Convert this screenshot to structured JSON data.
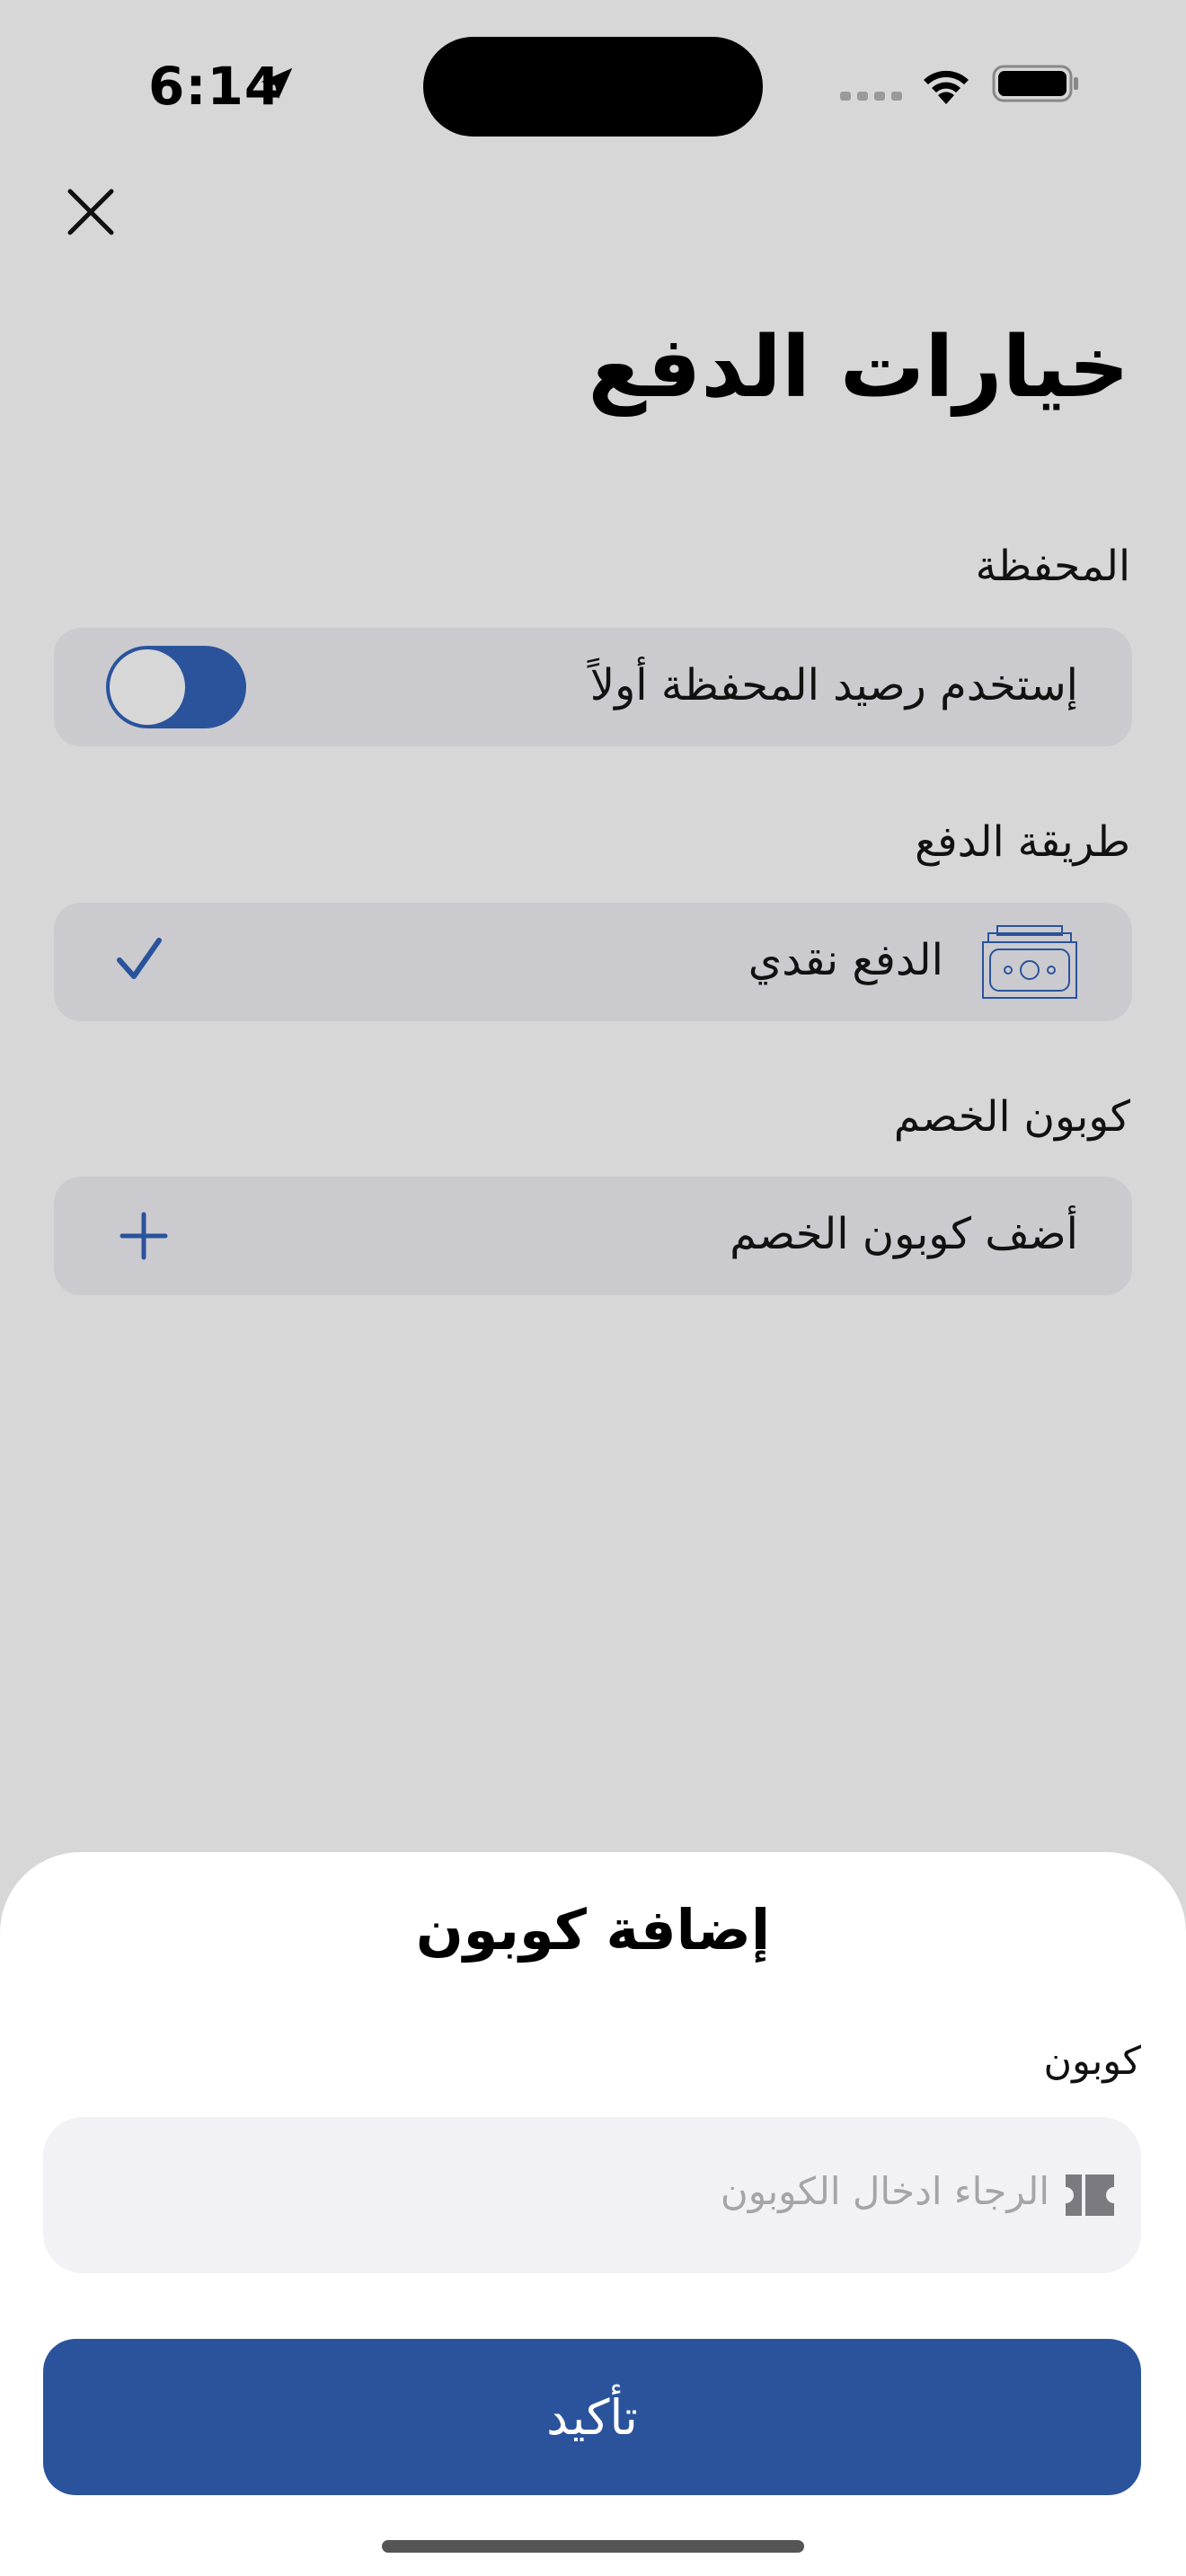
{
  "status_bar": {
    "time": "6:14"
  },
  "header": {
    "title": "خيارات الدفع"
  },
  "wallet": {
    "section_label": "المحفظة",
    "toggle_label": "إستخدم رصيد المحفظة أولاً",
    "toggle_on": true
  },
  "payment_method": {
    "section_label": "طريقة الدفع",
    "option_label": "الدفع نقدي",
    "selected": true
  },
  "coupon": {
    "section_label": "كوبون الخصم",
    "add_label": "أضف كوبون الخصم"
  },
  "sheet": {
    "title": "إضافة كوبون",
    "field_label": "كوبون",
    "input_placeholder": "الرجاء ادخال الكوبون",
    "input_value": "",
    "confirm_label": "تأكيد"
  },
  "colors": {
    "accent": "#2a539c",
    "background": "#d7d7d8",
    "card": "#cbcbcf",
    "sheet": "#ffffff",
    "input": "#f2f2f6"
  },
  "icons": {
    "close": "close-icon",
    "location": "location-arrow-icon",
    "wifi": "wifi-icon",
    "battery": "battery-icon",
    "cash": "cash-icon",
    "check": "checkmark-icon",
    "plus": "plus-icon",
    "ticket": "ticket-icon"
  }
}
